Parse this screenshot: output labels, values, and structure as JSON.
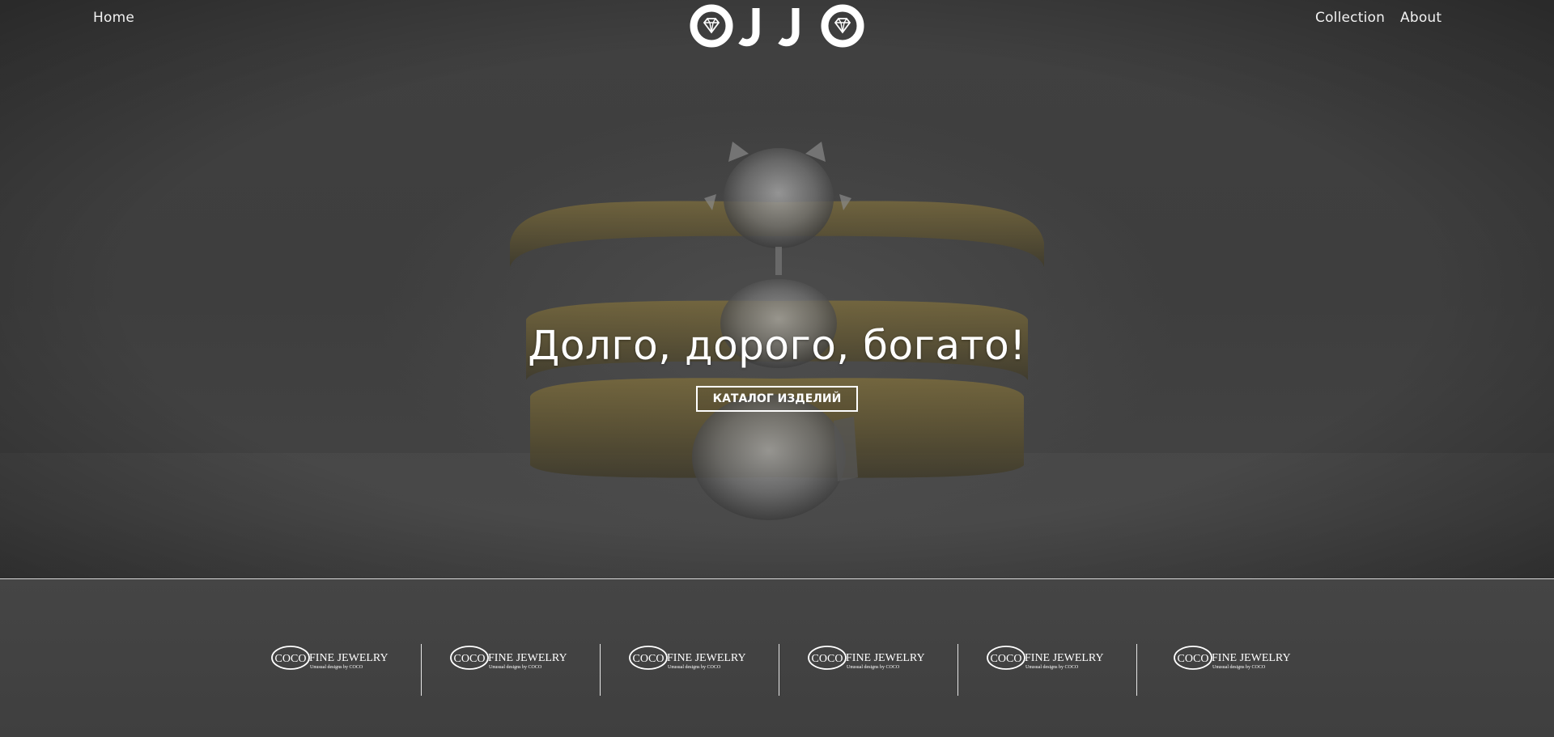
{
  "nav": {
    "home": "Home",
    "collection": "Collection",
    "about": "About"
  },
  "logo": {
    "letters": [
      "O",
      "J",
      "J",
      "O"
    ],
    "icon": "diamond-icon"
  },
  "hero": {
    "title": "Долго, дорого, богато!",
    "button_label": "КАТАЛОГ ИЗДЕЛИЙ"
  },
  "brands": [
    {
      "mark": "COCO",
      "name": "FINE JEWELRY",
      "tagline": "Unusual designs by COCO"
    },
    {
      "mark": "COCO",
      "name": "FINE JEWELRY",
      "tagline": "Unusual designs by COCO"
    },
    {
      "mark": "COCO",
      "name": "FINE JEWELRY",
      "tagline": "Unusual designs by COCO"
    },
    {
      "mark": "COCO",
      "name": "FINE JEWELRY",
      "tagline": "Unusual designs by COCO"
    },
    {
      "mark": "COCO",
      "name": "FINE JEWELRY",
      "tagline": "Unusual designs by COCO"
    },
    {
      "mark": "COCO",
      "name": "FINE JEWELRY",
      "tagline": "Unusual designs by COCO"
    }
  ],
  "colors": {
    "background": "#3a3a3a",
    "text": "#ffffff",
    "gold": "#a8904a"
  }
}
